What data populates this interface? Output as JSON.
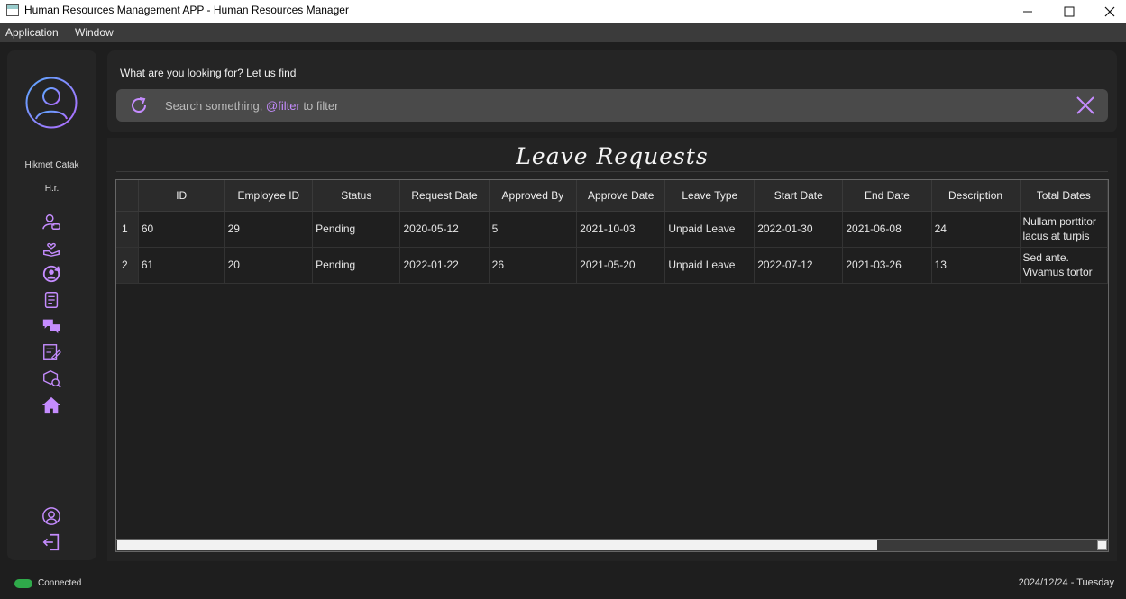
{
  "window": {
    "title": "Human Resources Management APP - Human Resources Manager"
  },
  "menu": {
    "items": [
      "Application",
      "Window"
    ]
  },
  "user": {
    "name": "Hikmet Catak",
    "role": "H.r."
  },
  "nav": {
    "icons": [
      "user-settings-icon",
      "hand-heart-icon",
      "user-cycle-icon",
      "document-badge-icon",
      "chat-icon",
      "form-edit-icon",
      "box-search-icon",
      "home-icon",
      "profile-icon",
      "logout-icon"
    ]
  },
  "search": {
    "hint": "What are you looking for? Let us find",
    "placeholder_prefix": "Search something, ",
    "placeholder_filter": "@filter",
    "placeholder_suffix": " to filter"
  },
  "page": {
    "title": "Leave Requests"
  },
  "table": {
    "columns": [
      "ID",
      "Employee ID",
      "Status",
      "Request Date",
      "Approved By",
      "Approve Date",
      "Leave Type",
      "Start Date",
      "End Date",
      "Description",
      "Total Dates"
    ],
    "rows": [
      {
        "num": "1",
        "id": "60",
        "employee_id": "29",
        "status": "Pending",
        "request_date": "2020-05-12",
        "approved_by": "5",
        "approve_date": "2021-10-03",
        "leave_type": "Unpaid Leave",
        "start_date": "2022-01-30",
        "end_date": "2021-06-08",
        "description": "24",
        "total_dates": "Nullam porttitor lacus at turpis"
      },
      {
        "num": "2",
        "id": "61",
        "employee_id": "20",
        "status": "Pending",
        "request_date": "2022-01-22",
        "approved_by": "26",
        "approve_date": "2021-05-20",
        "leave_type": "Unpaid Leave",
        "start_date": "2022-07-12",
        "end_date": "2021-03-26",
        "description": "13",
        "total_dates": "Sed ante. Vivamus tortor"
      }
    ]
  },
  "status": {
    "connection": "Connected",
    "date": "2024/12/24 - Tuesday"
  },
  "colors": {
    "accent": "#c58cff",
    "connected": "#2faa4a",
    "background": "#1e1e1e",
    "panel": "#252525"
  }
}
